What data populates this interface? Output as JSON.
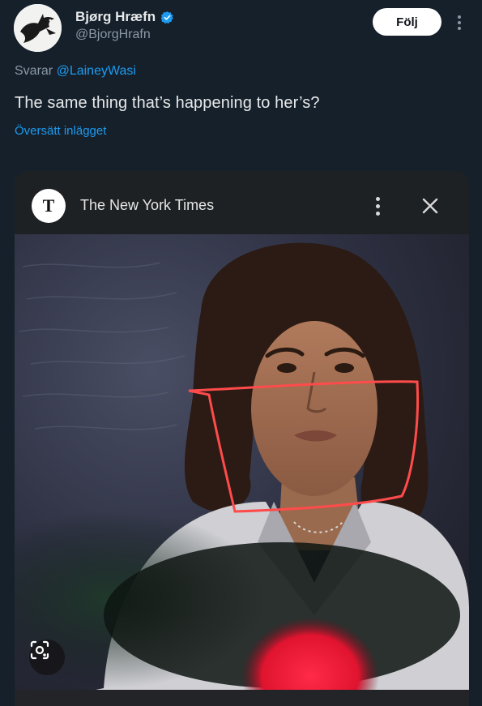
{
  "author": {
    "display_name": "Bjørg Hræfn",
    "handle": "@BjorgHrafn",
    "verified": true,
    "avatar_icon": "raven-icon"
  },
  "follow_button_label": "Följ",
  "more_icon": "more-vertical-icon",
  "reply": {
    "prefix": "Svarar",
    "mention": "@LaineyWasi"
  },
  "tweet_text": "The same thing that’s happening to her’s?",
  "translate_label": "Översätt inlägget",
  "card": {
    "source_title": "The New York Times",
    "logo_icon": "nyt-logo-icon",
    "more_icon": "more-vertical-icon",
    "close_icon": "close-icon",
    "lens_icon": "image-search-icon"
  },
  "colors": {
    "background": "#15202b",
    "accent": "#1d9bf0",
    "annotation": "#ff4b4b"
  }
}
